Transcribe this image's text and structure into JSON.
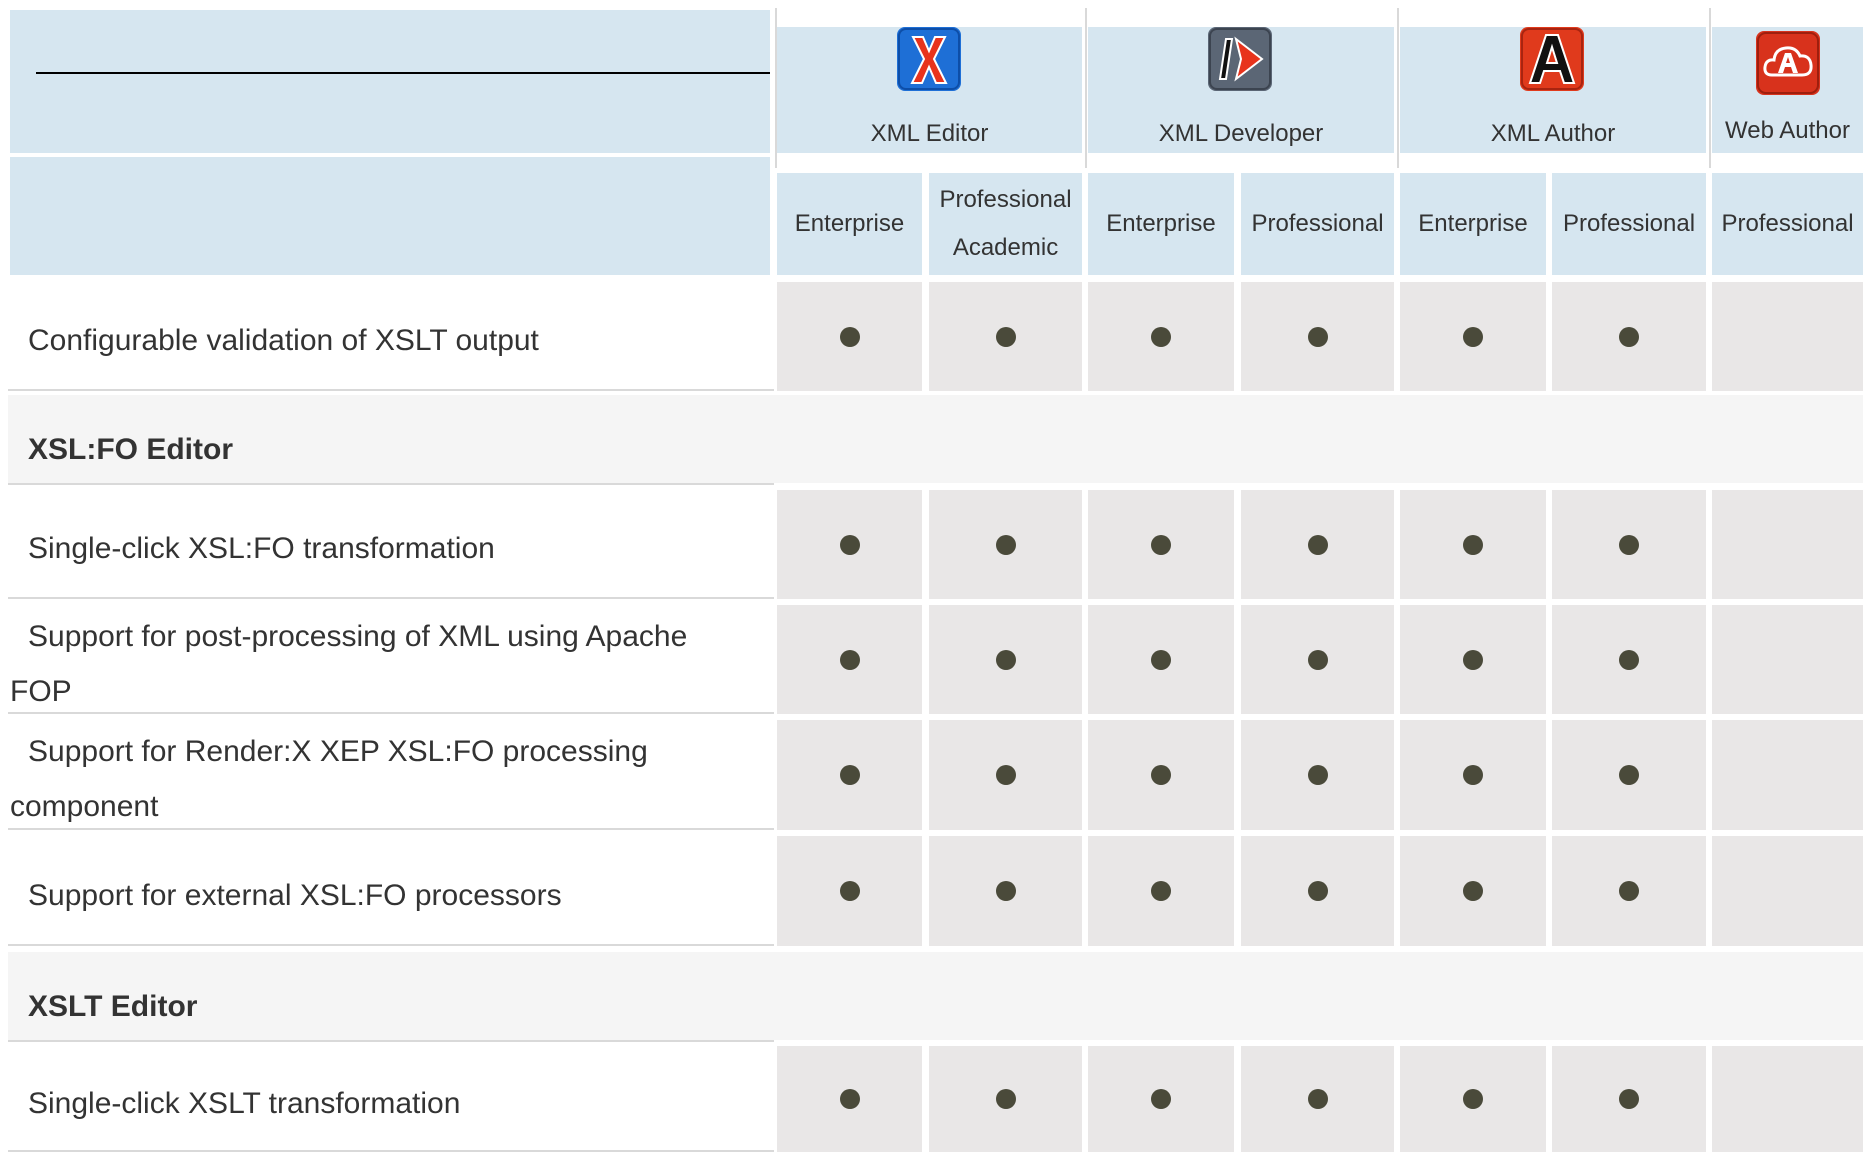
{
  "products": [
    {
      "name": "XML Editor",
      "icon": "xml-editor-icon",
      "color": "#1e6fd6"
    },
    {
      "name": "XML Developer",
      "icon": "xml-developer-icon",
      "color": "#5b6675"
    },
    {
      "name": "XML Author",
      "icon": "xml-author-icon",
      "color": "#e03a1c"
    },
    {
      "name": "Web Author",
      "icon": "web-author-icon",
      "color": "#d8321c"
    }
  ],
  "editions": [
    "Enterprise",
    "Professional Academic",
    "Enterprise",
    "Professional",
    "Enterprise",
    "Professional",
    "Professional"
  ],
  "rows": [
    {
      "type": "feature",
      "label": "Configurable validation of XSLT output",
      "support": [
        true,
        true,
        true,
        true,
        true,
        true,
        false
      ]
    },
    {
      "type": "section",
      "label": "XSL:FO Editor"
    },
    {
      "type": "feature",
      "label": "Single-click XSL:FO transformation",
      "support": [
        true,
        true,
        true,
        true,
        true,
        true,
        false
      ]
    },
    {
      "type": "feature",
      "label": "Support for post-processing of XML using Apache FOP",
      "support": [
        true,
        true,
        true,
        true,
        true,
        true,
        false
      ]
    },
    {
      "type": "feature",
      "label": "Support for Render:X XEP XSL:FO processing component",
      "support": [
        true,
        true,
        true,
        true,
        true,
        true,
        false
      ]
    },
    {
      "type": "feature",
      "label": "Support for external XSL:FO processors",
      "support": [
        true,
        true,
        true,
        true,
        true,
        true,
        false
      ]
    },
    {
      "type": "section",
      "label": "XSLT Editor"
    },
    {
      "type": "feature",
      "label": "Single-click XSLT transformation",
      "support": [
        true,
        true,
        true,
        true,
        true,
        true,
        false
      ]
    }
  ]
}
